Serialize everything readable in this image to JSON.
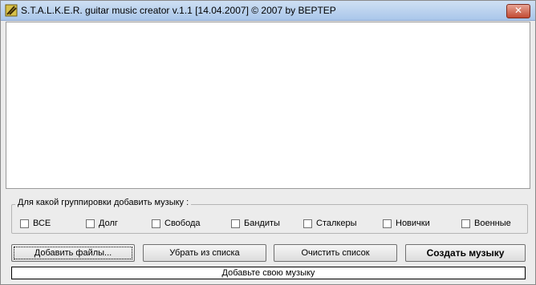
{
  "window": {
    "title": "S.T.A.L.K.E.R. guitar music creator v.1.1  [14.04.2007] © 2007 by BEPTEP",
    "close_label": "✕"
  },
  "group": {
    "legend": "Для какой группировки добавить музыку :",
    "options": [
      {
        "label": "ВСЕ",
        "checked": false
      },
      {
        "label": "Долг",
        "checked": false
      },
      {
        "label": "Свобода",
        "checked": false
      },
      {
        "label": "Бандиты",
        "checked": false
      },
      {
        "label": "Сталкеры",
        "checked": false
      },
      {
        "label": "Новички",
        "checked": false
      },
      {
        "label": "Военные",
        "checked": false
      }
    ]
  },
  "buttons": {
    "add_files": "Добавить файлы...",
    "remove_from_list": "Убрать из списка",
    "clear_list": "Очистить список",
    "create_music": "Создать музыку"
  },
  "status": {
    "text": "Добавьте свою музыку"
  },
  "colors": {
    "titlebar": "#a9c6ea",
    "close_button": "#c24a33",
    "background": "#ececec"
  }
}
